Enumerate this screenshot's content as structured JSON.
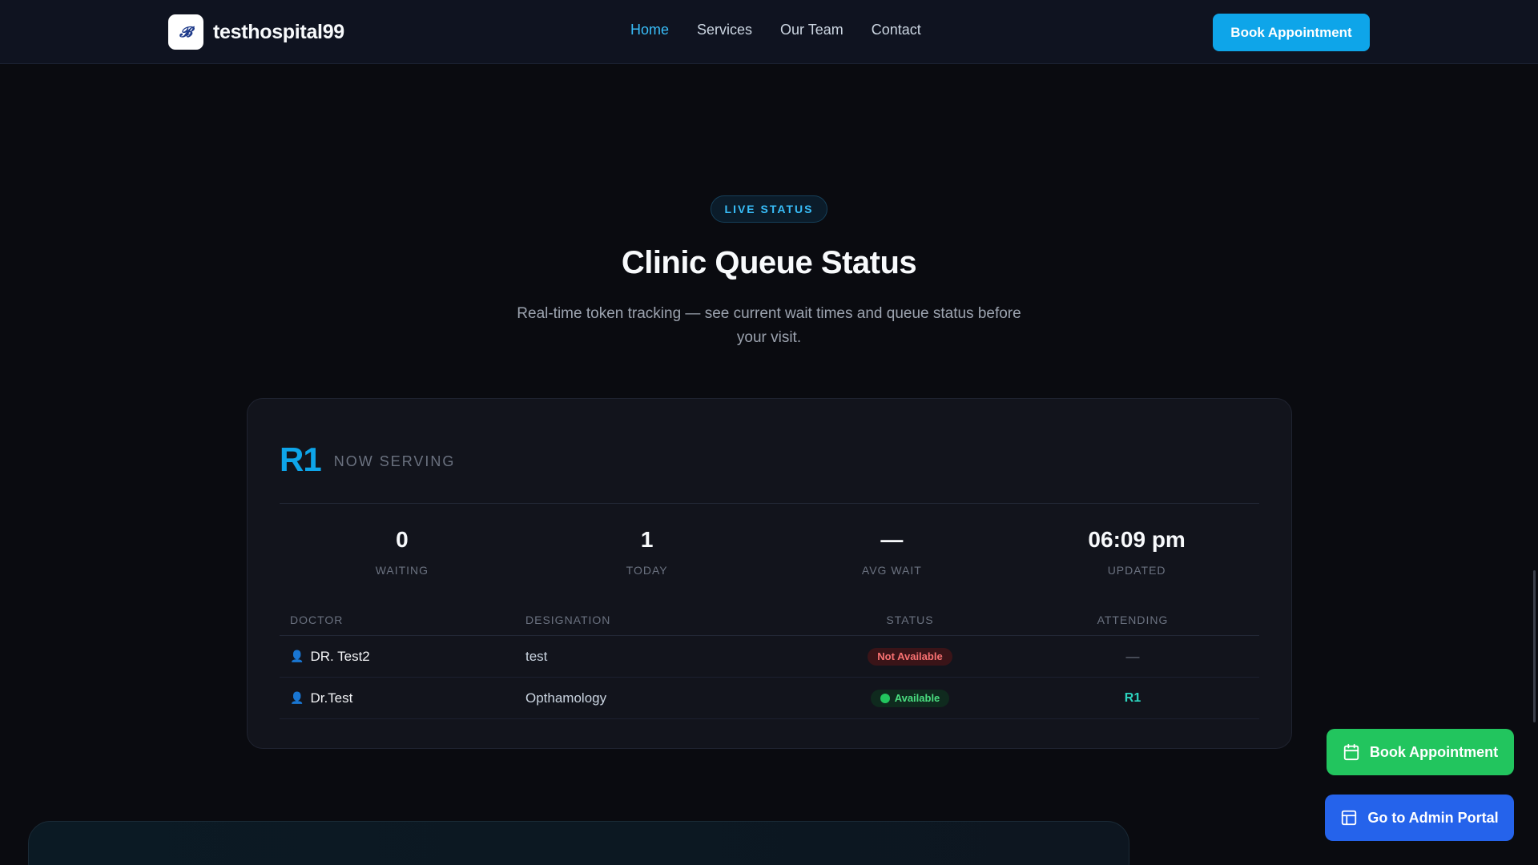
{
  "navbar": {
    "brand_name": "testhospital99",
    "links": [
      "Home",
      "Services",
      "Our Team",
      "Contact"
    ],
    "active_link": "Home",
    "book_label": "Book Appointment"
  },
  "hero": {
    "badge": "LIVE STATUS",
    "title": "Clinic Queue Status",
    "subtitle": "Real-time token tracking — see current wait times and queue status before your visit."
  },
  "queue": {
    "now_serving_token": "R1",
    "now_serving_label": "NOW SERVING",
    "stats": [
      {
        "value": "0",
        "label": "WAITING"
      },
      {
        "value": "1",
        "label": "TODAY"
      },
      {
        "value": "—",
        "label": "AVG WAIT"
      },
      {
        "value": "06:09 pm",
        "label": "UPDATED"
      }
    ],
    "columns": [
      "DOCTOR",
      "DESIGNATION",
      "STATUS",
      "ATTENDING"
    ],
    "rows": [
      {
        "doctor": "DR. Test2",
        "designation": "test",
        "status": "Not Available",
        "attending": "—"
      },
      {
        "doctor": "Dr.Test",
        "designation": "Opthamology",
        "status": "Available",
        "attending": "R1"
      }
    ]
  },
  "floating": {
    "book_label": "Book Appointment",
    "admin_label": "Go to Admin Portal"
  },
  "colors": {
    "accent": "#0ea5e9",
    "available": "#22c55e",
    "not_available": "#f87171",
    "admin_button": "#2563eb"
  },
  "icons": {
    "logo": "hospital-logo",
    "doctor": "person-icon",
    "calendar": "calendar-icon",
    "admin": "layout-icon"
  }
}
